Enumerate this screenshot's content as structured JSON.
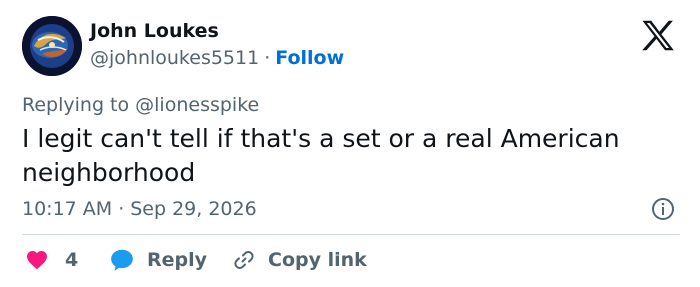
{
  "author": {
    "name": "John Loukes",
    "handle": "@johnloukes5511",
    "separator": "·",
    "follow_label": "Follow"
  },
  "reply_context": "Replying to @lionesspike",
  "tweet_text": "I legit can't tell if that's a set or a real American neighborhood",
  "meta": {
    "time": "10:17 AM",
    "separator": "·",
    "date": "Sep 29, 2026"
  },
  "actions": {
    "like_count": "4",
    "reply_label": "Reply",
    "copy_link_label": "Copy link"
  },
  "icons": {
    "brand": "x-logo-icon",
    "info": "info-icon",
    "like": "heart-icon",
    "reply": "speech-bubble-icon",
    "copy": "link-icon"
  },
  "colors": {
    "text": "#0f1419",
    "secondary_text": "#536471",
    "follow": "#006fd6",
    "like": "#f91880",
    "reply_icon": "#1d9bf0",
    "divider": "#cfd9de"
  }
}
